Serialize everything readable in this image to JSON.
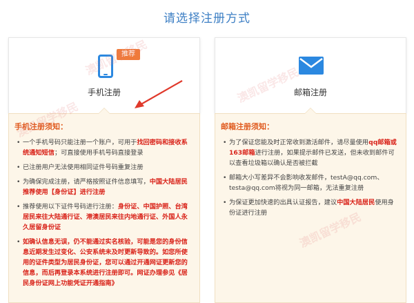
{
  "page": {
    "title": "请选择注册方式"
  },
  "phone_option": {
    "label": "手机注册",
    "badge": "推荐",
    "icon": "phone-icon",
    "color": "#2b88e0"
  },
  "email_option": {
    "label": "邮箱注册",
    "icon": "mail-icon",
    "color": "#2b88e0"
  },
  "phone_notice": {
    "title": "手机注册须知：",
    "items": [
      [
        "一个手机号码只能注册一个账户，可用于",
        "找回密码和接收系统通知短信",
        "；可直接使用手机号码直接登录"
      ],
      [
        "已注册用户无法使用相同证件号码重复注册",
        "",
        ""
      ],
      [
        "为确保完成注册，请严格按照证件信息填写，",
        "中国大陆居民推荐使用【身份证】进行注册",
        ""
      ],
      [
        "推荐使用以下证件号码进行注册：",
        "身份证、中国护照、台湾居民来往大陆通行证、港澳居民来往内地通行证、外国人永久居留身份证",
        ""
      ],
      [
        "",
        "如确认信息无误，仍不能通过实名核验，可能是您的身份信息近期发生过变化、公安系统未及时更新导致的。如您所使用的证件类型为居民身份证，您可以通过开通网证更新您的信息，而后再登录本系统进行注册即可。网证办理参见《居民身份证网上功能凭证开通指南》",
        ""
      ]
    ]
  },
  "email_notice": {
    "title": "邮箱注册须知：",
    "items": [
      [
        "为了保证您能及时正常收到激活邮件，请尽量使用",
        "qq邮箱或163邮箱",
        "进行注册，如果提示邮件已发送，但未收到邮件可以查看垃圾箱以确认是否被拦截"
      ],
      [
        "邮箱大小写差异不会影响收发邮件，testA@qq.com、testa@qq.com将视为同一邮箱，无法重复注册",
        "",
        ""
      ],
      [
        "为保证更加快速的出具认证报告，建议",
        "中国大陆居民",
        "使用身份证进行注册"
      ]
    ]
  },
  "watermark": {
    "text": "澳凯留学移民 VISA VICTORY"
  }
}
